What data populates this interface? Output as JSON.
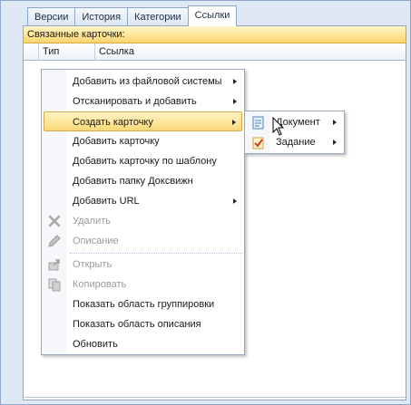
{
  "tabs": [
    "Версии",
    "История",
    "Категории",
    "Ссылки"
  ],
  "panel": {
    "group_title": "Связанные карточки:",
    "columns": {
      "type": "Тип",
      "link": "Ссылка"
    }
  },
  "context_menu": {
    "items": [
      {
        "label": "Добавить из файловой системы",
        "icon": "",
        "disabled": false,
        "submenu": true
      },
      {
        "label": "Отсканировать и добавить",
        "icon": "",
        "disabled": false,
        "submenu": true
      },
      {
        "label": "Создать карточку",
        "icon": "",
        "disabled": false,
        "submenu": true,
        "highlighted": true
      },
      {
        "label": "Добавить карточку",
        "icon": "",
        "disabled": false,
        "submenu": false
      },
      {
        "label": "Добавить карточку по шаблону",
        "icon": "",
        "disabled": false,
        "submenu": false
      },
      {
        "label": "Добавить папку Доксвижн",
        "icon": "",
        "disabled": false,
        "submenu": false
      },
      {
        "label": "Добавить URL",
        "icon": "",
        "disabled": false,
        "submenu": true
      },
      {
        "label": "Удалить",
        "icon": "delete-icon",
        "disabled": true,
        "submenu": false
      },
      {
        "label": "Описание",
        "icon": "pencil-icon",
        "disabled": true,
        "submenu": false
      },
      {
        "label": "Открыть",
        "icon": "open-icon",
        "disabled": true,
        "submenu": false
      },
      {
        "label": "Копировать",
        "icon": "copy-icon",
        "disabled": true,
        "submenu": false
      },
      {
        "label": "Показать область группировки",
        "icon": "",
        "disabled": false,
        "submenu": false
      },
      {
        "label": "Показать область описания",
        "icon": "",
        "disabled": false,
        "submenu": false
      },
      {
        "label": "Обновить",
        "icon": "",
        "disabled": false,
        "submenu": false
      }
    ]
  },
  "submenu": {
    "items": [
      {
        "label": "Документ",
        "icon": "document-icon",
        "submenu": true
      },
      {
        "label": "Задание",
        "icon": "task-icon",
        "submenu": true
      }
    ]
  },
  "colors": {
    "highlight": "#fcd978",
    "group_header": "#fbd46e",
    "window_bg": "#dfe9f5"
  }
}
